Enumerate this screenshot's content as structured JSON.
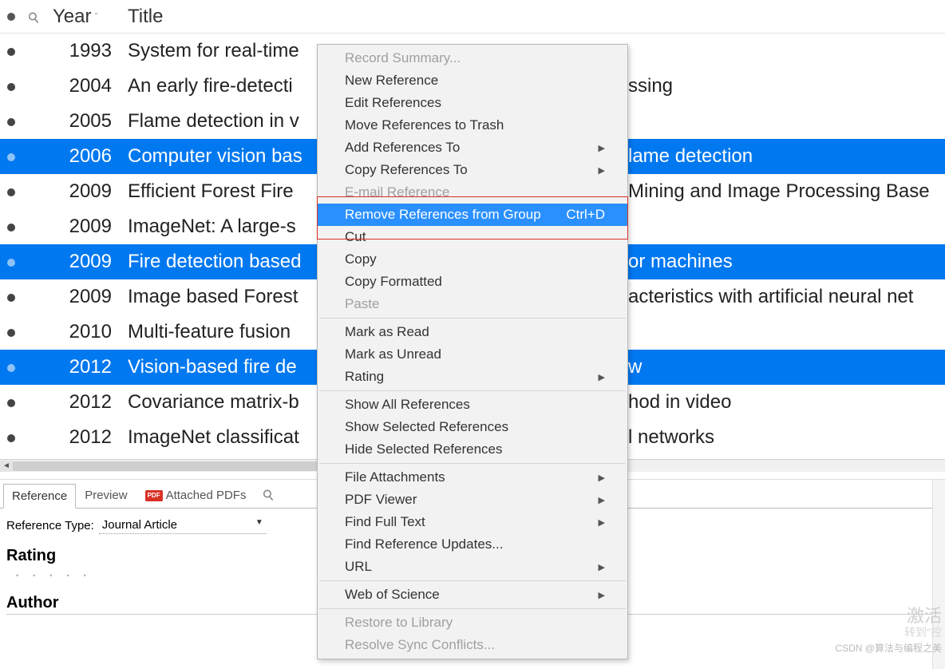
{
  "columns": {
    "year": "Year",
    "title": "Title"
  },
  "rows": [
    {
      "year": "1993",
      "title": "System for real-time",
      "selected": false
    },
    {
      "year": "2004",
      "title": "An early fire-detecti",
      "title_after": "ssing",
      "selected": false
    },
    {
      "year": "2005",
      "title": "Flame detection in v",
      "selected": false
    },
    {
      "year": "2006",
      "title": "Computer vision bas",
      "title_after": "lame detection",
      "selected": true
    },
    {
      "year": "2009",
      "title": "Efficient Forest Fire ",
      "title_after": "Mining and Image Processing Base",
      "selected": false
    },
    {
      "year": "2009",
      "title": "ImageNet: A large-s",
      "selected": false
    },
    {
      "year": "2009",
      "title": "Fire detection based",
      "title_after": "or machines",
      "selected": true
    },
    {
      "year": "2009",
      "title": "Image based Forest ",
      "title_after": "acteristics with artificial neural net",
      "selected": false
    },
    {
      "year": "2010",
      "title": "Multi-feature fusion",
      "selected": false
    },
    {
      "year": "2012",
      "title": "Vision-based fire de",
      "title_after": "w",
      "selected": true
    },
    {
      "year": "2012",
      "title": "Covariance matrix-b",
      "title_after": "hod in video",
      "selected": false
    },
    {
      "year": "2012",
      "title": "ImageNet classificat",
      "title_after": "l networks",
      "selected": false
    }
  ],
  "context_menu": {
    "groups": [
      [
        {
          "label": "Record Summary...",
          "disabled": true
        },
        {
          "label": "New Reference"
        },
        {
          "label": "Edit References"
        },
        {
          "label": "Move References to Trash"
        },
        {
          "label": "Add References To",
          "submenu": true
        },
        {
          "label": "Copy References To",
          "submenu": true
        },
        {
          "label": "E-mail Reference",
          "disabled": true
        },
        {
          "label": "Remove References from Group",
          "shortcut": "Ctrl+D",
          "highlighted": true
        },
        {
          "label": "Cut"
        },
        {
          "label": "Copy"
        },
        {
          "label": "Copy Formatted"
        },
        {
          "label": "Paste",
          "disabled": true
        }
      ],
      [
        {
          "label": "Mark as Read"
        },
        {
          "label": "Mark as Unread"
        },
        {
          "label": "Rating",
          "submenu": true
        }
      ],
      [
        {
          "label": "Show All References"
        },
        {
          "label": "Show Selected References"
        },
        {
          "label": "Hide Selected References"
        }
      ],
      [
        {
          "label": "File Attachments",
          "submenu": true
        },
        {
          "label": "PDF Viewer",
          "submenu": true
        },
        {
          "label": "Find Full Text",
          "submenu": true
        },
        {
          "label": "Find Reference Updates..."
        },
        {
          "label": "URL",
          "submenu": true
        }
      ],
      [
        {
          "label": "Web of Science",
          "submenu": true
        }
      ],
      [
        {
          "label": "Restore to Library",
          "disabled": true
        },
        {
          "label": "Resolve Sync Conflicts...",
          "disabled": true
        }
      ]
    ]
  },
  "tabs": {
    "reference": "Reference",
    "preview": "Preview",
    "attached_pdfs": "Attached PDFs",
    "pdf_badge": "PDF"
  },
  "detail": {
    "ref_type_label": "Reference Type:",
    "ref_type_value": "Journal Article",
    "rating_label": "Rating",
    "author_label": "Author"
  },
  "footer": {
    "activate": "激活",
    "activate_sub": "转到\"控",
    "watermark": "CSDN @算法与编程之美"
  }
}
